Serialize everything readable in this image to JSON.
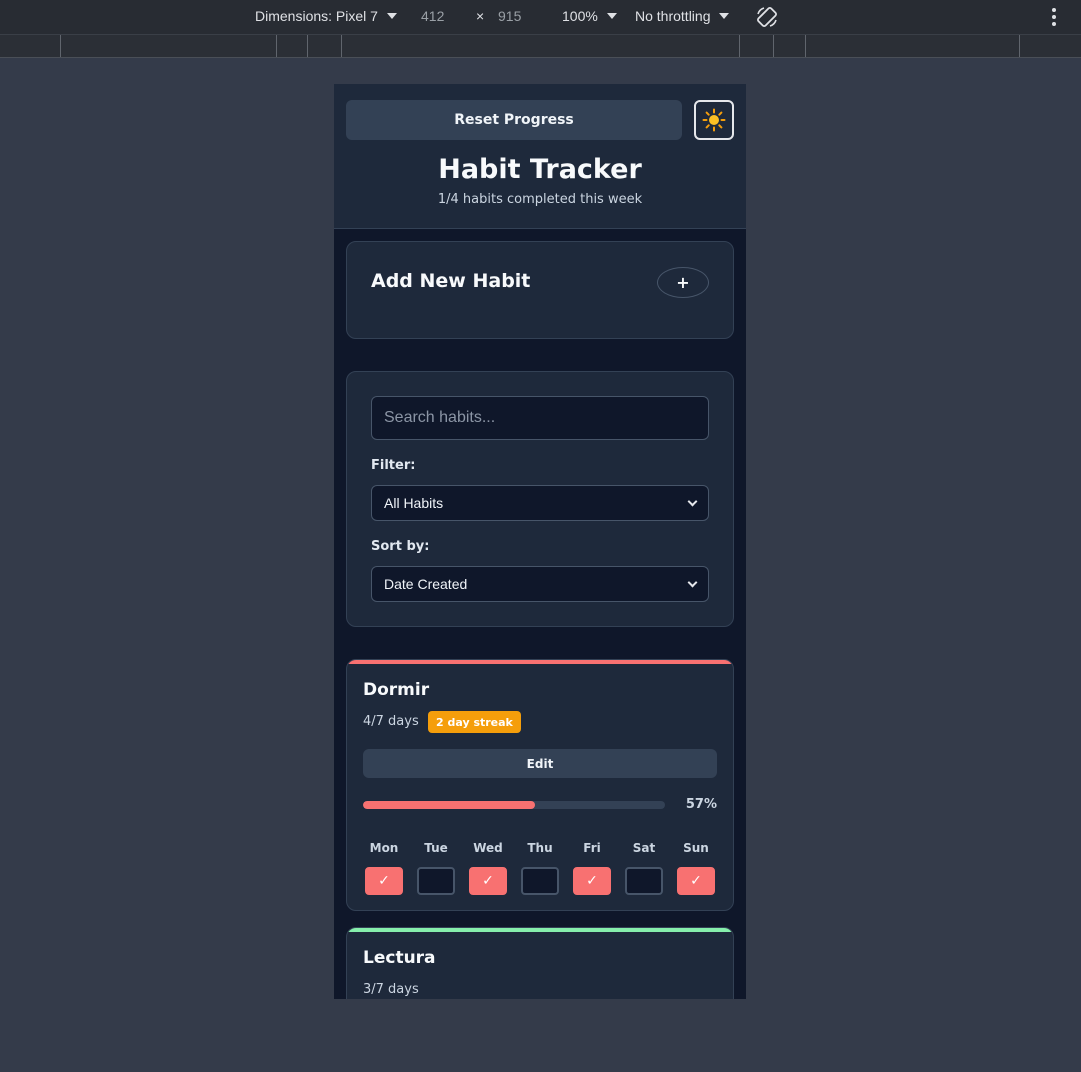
{
  "devtools": {
    "dimensions_label": "Dimensions: Pixel 7",
    "width": "412",
    "times": "×",
    "height": "915",
    "zoom": "100%",
    "throttling": "No throttling"
  },
  "app": {
    "reset_label": "Reset Progress",
    "theme_icon": "☀️",
    "title": "Habit Tracker",
    "subtitle": "1/4 habits completed this week",
    "add_habit": {
      "title": "Add New Habit",
      "button": "+"
    },
    "search": {
      "placeholder": "Search habits..."
    },
    "filter": {
      "label": "Filter:",
      "selected": "All Habits"
    },
    "sort": {
      "label": "Sort by:",
      "selected": "Date Created"
    },
    "colors": {
      "accent_red": "#f87171",
      "accent_green": "#86efac",
      "streak": "#f59e0b"
    },
    "habits": [
      {
        "name": "Dormir",
        "days_text": "4/7 days",
        "streak": "2 day streak",
        "edit_label": "Edit",
        "progress": 57,
        "progress_text": "57%",
        "days": [
          {
            "label": "Mon",
            "done": true,
            "mark": "✓"
          },
          {
            "label": "Tue",
            "done": false,
            "mark": ""
          },
          {
            "label": "Wed",
            "done": true,
            "mark": "✓"
          },
          {
            "label": "Thu",
            "done": false,
            "mark": ""
          },
          {
            "label": "Fri",
            "done": true,
            "mark": "✓"
          },
          {
            "label": "Sat",
            "done": false,
            "mark": ""
          },
          {
            "label": "Sun",
            "done": true,
            "mark": "✓"
          }
        ]
      },
      {
        "name": "Lectura",
        "days_text": "3/7 days"
      }
    ]
  }
}
